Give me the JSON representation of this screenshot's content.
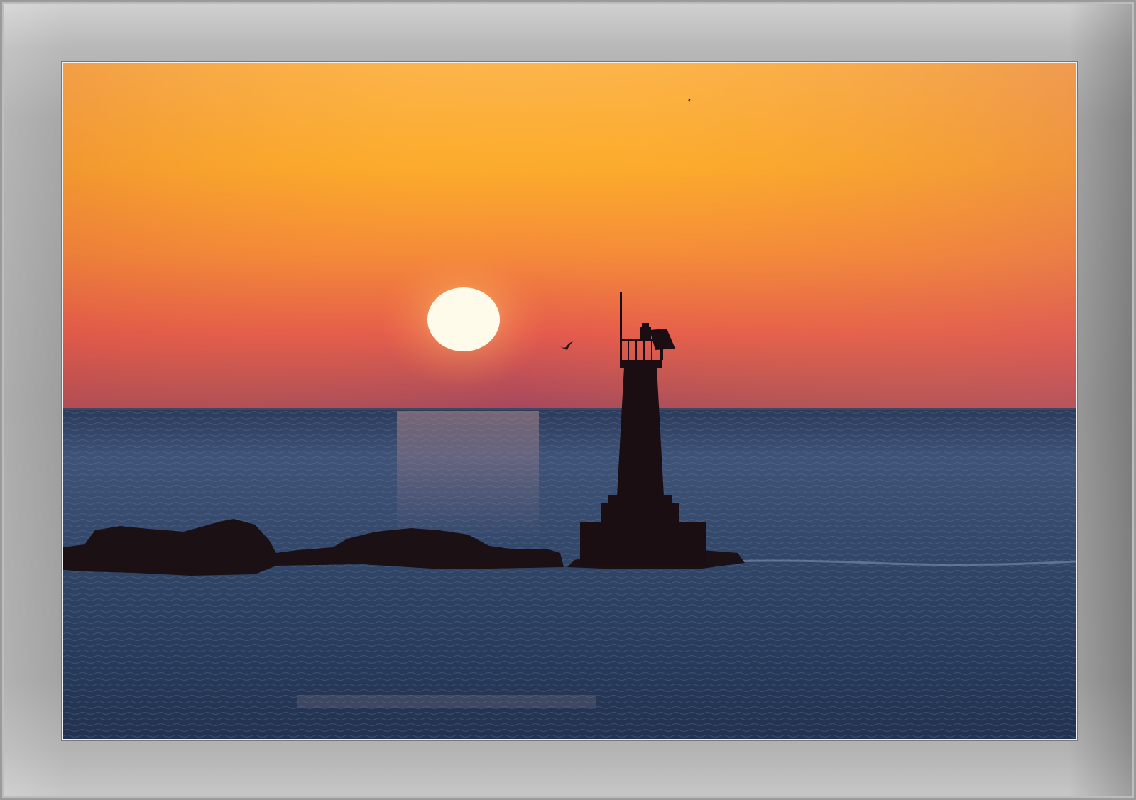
{
  "photo": {
    "subject": "lighthouse-at-sunrise",
    "colors": {
      "sky_top": "#fbbd4f",
      "sky_mid": "#f59a3a",
      "sky_low": "#e45a4a",
      "sky_horizon": "#a5485a",
      "sun": "#fffbe8",
      "sea_dark": "#1a2a45",
      "sea_mid": "#35496a",
      "silhouette": "#1b0f12"
    }
  }
}
